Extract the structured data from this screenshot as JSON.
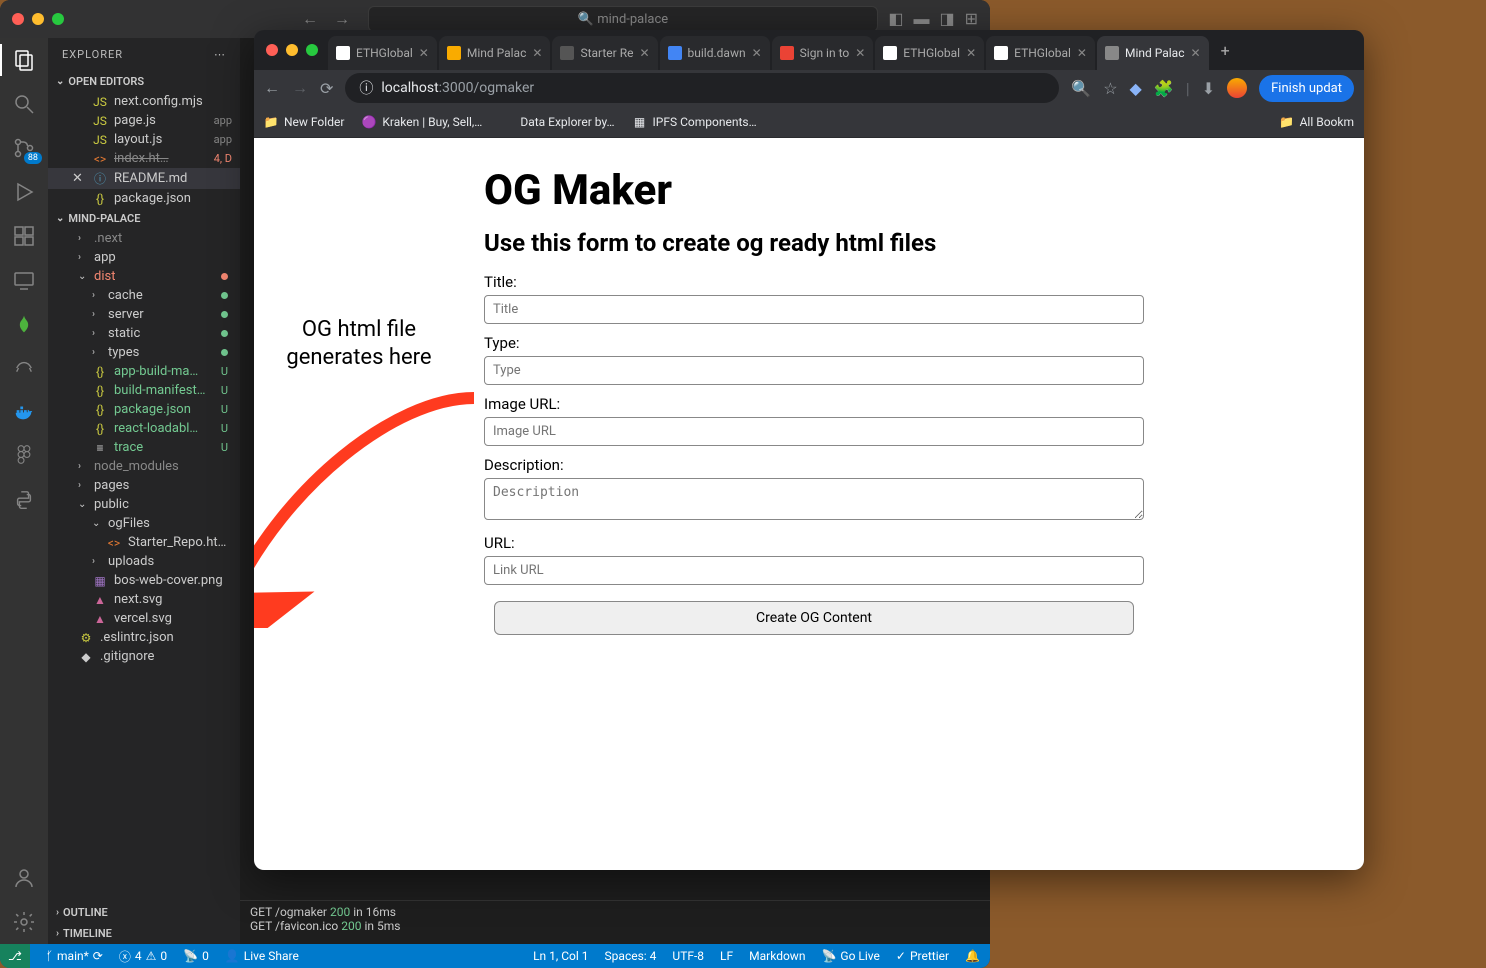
{
  "vscode": {
    "title": "mind-palace",
    "explorer_label": "EXPLORER",
    "open_editors_label": "OPEN EDITORS",
    "project_label": "MIND-PALACE",
    "outline_label": "OUTLINE",
    "timeline_label": "TIMELINE",
    "scm_badge": "88",
    "open_editors": [
      {
        "icon": "JS",
        "icls": "fi-js",
        "name": "next.config.mjs",
        "meta": ""
      },
      {
        "icon": "JS",
        "icls": "fi-js",
        "name": "page.js",
        "meta": "app"
      },
      {
        "icon": "JS",
        "icls": "fi-js",
        "name": "layout.js",
        "meta": "app"
      },
      {
        "icon": "<>",
        "icls": "fi-html",
        "name": "index.ht…",
        "meta": "4, D",
        "strike": true
      },
      {
        "icon": "ⓘ",
        "icls": "fi-md",
        "name": "README.md",
        "meta": "",
        "active": true,
        "close": true
      },
      {
        "icon": "{}",
        "icls": "fi-json",
        "name": "package.json",
        "meta": ""
      }
    ],
    "tree": [
      {
        "type": "folder",
        "name": ".next",
        "indent": 1,
        "chev": "›",
        "dim": true
      },
      {
        "type": "folder",
        "name": "app",
        "indent": 1,
        "chev": "›"
      },
      {
        "type": "folder",
        "name": "dist",
        "indent": 1,
        "chev": "⌄",
        "cls": "dist-red",
        "dot": "#f48771"
      },
      {
        "type": "folder",
        "name": "cache",
        "indent": 2,
        "chev": "›",
        "dot": "#73c991"
      },
      {
        "type": "folder",
        "name": "server",
        "indent": 2,
        "chev": "›",
        "dot": "#73c991"
      },
      {
        "type": "folder",
        "name": "static",
        "indent": 2,
        "chev": "›",
        "dot": "#73c991"
      },
      {
        "type": "folder",
        "name": "types",
        "indent": 2,
        "chev": "›",
        "dot": "#73c991"
      },
      {
        "type": "file",
        "icon": "{}",
        "icls": "fi-json",
        "name": "app-build-ma…",
        "indent": 2,
        "git": "U",
        "cls": "green-name"
      },
      {
        "type": "file",
        "icon": "{}",
        "icls": "fi-json",
        "name": "build-manifest…",
        "indent": 2,
        "git": "U",
        "cls": "green-name"
      },
      {
        "type": "file",
        "icon": "{}",
        "icls": "fi-json",
        "name": "package.json",
        "indent": 2,
        "git": "U",
        "cls": "green-name"
      },
      {
        "type": "file",
        "icon": "{}",
        "icls": "fi-json",
        "name": "react-loadabl…",
        "indent": 2,
        "git": "U",
        "cls": "green-name"
      },
      {
        "type": "file",
        "icon": "≡",
        "icls": "fi-folder",
        "name": "trace",
        "indent": 2,
        "git": "U",
        "cls": "green-name"
      },
      {
        "type": "folder",
        "name": "node_modules",
        "indent": 1,
        "chev": "›",
        "dim": true
      },
      {
        "type": "folder",
        "name": "pages",
        "indent": 1,
        "chev": "›"
      },
      {
        "type": "folder",
        "name": "public",
        "indent": 1,
        "chev": "⌄"
      },
      {
        "type": "folder",
        "name": "ogFiles",
        "indent": 2,
        "chev": "⌄"
      },
      {
        "type": "file",
        "icon": "<>",
        "icls": "fi-html",
        "name": "Starter_Repo.html",
        "indent": 3
      },
      {
        "type": "folder",
        "name": "uploads",
        "indent": 2,
        "chev": "›"
      },
      {
        "type": "file",
        "icon": "▦",
        "icls": "fi-img",
        "name": "bos-web-cover.png",
        "indent": 2
      },
      {
        "type": "file",
        "icon": "▲",
        "icls": "fi-svg",
        "name": "next.svg",
        "indent": 2
      },
      {
        "type": "file",
        "icon": "▲",
        "icls": "fi-svg",
        "name": "vercel.svg",
        "indent": 2
      },
      {
        "type": "file",
        "icon": "⚙",
        "icls": "fi-json",
        "name": ".eslintrc.json",
        "indent": 1
      },
      {
        "type": "file",
        "icon": "◆",
        "icls": "fi-folder",
        "name": ".gitignore",
        "indent": 1
      }
    ],
    "terminal": {
      "l1a": "GET /ogmaker",
      "l1b": "200",
      "l1c": "in 16ms",
      "l2a": "GET /favicon.ico",
      "l2b": "200",
      "l2c": "in 5ms"
    },
    "status": {
      "branch": "main*",
      "errors": "4",
      "warnings": "0",
      "port": "0",
      "liveshare": "Live Share",
      "pos": "Ln 1, Col 1",
      "spaces": "Spaces: 4",
      "enc": "UTF-8",
      "eol": "LF",
      "mode": "Markdown",
      "golive": "Go Live",
      "prettier": "Prettier"
    }
  },
  "browser": {
    "tabs": [
      {
        "title": "ETHGlobal",
        "color": "#fff"
      },
      {
        "title": "Mind Palac",
        "color": "#f9ab00"
      },
      {
        "title": "Starter Re",
        "color": "#555"
      },
      {
        "title": "build.dawn",
        "color": "#4285f4"
      },
      {
        "title": "Sign in to",
        "color": "#ea4335"
      },
      {
        "title": "ETHGlobal",
        "color": "#fff"
      },
      {
        "title": "ETHGlobal",
        "color": "#fff"
      },
      {
        "title": "Mind Palac",
        "color": "#888",
        "active": true
      }
    ],
    "url_host": "localhost",
    "url_port": ":3000",
    "url_path": "/ogmaker",
    "update": "Finish updat",
    "bookmarks": [
      {
        "label": "New Folder",
        "ico": "📁"
      },
      {
        "label": "Kraken | Buy, Sell,…",
        "ico": "🟣"
      },
      {
        "label": "Data Explorer by…",
        "ico": "</>"
      },
      {
        "label": "IPFS Components…",
        "ico": "▦"
      }
    ],
    "all_bookmarks": "All Bookm"
  },
  "form": {
    "h1": "OG Maker",
    "h2": "Use this form to create og ready html files",
    "title_label": "Title:",
    "title_ph": "Title",
    "type_label": "Type:",
    "type_ph": "Type",
    "image_label": "Image URL:",
    "image_ph": "Image URL",
    "desc_label": "Description:",
    "desc_ph": "Description",
    "url_label": "URL:",
    "url_ph": "Link URL",
    "submit": "Create OG Content"
  },
  "annotation": "OG html file generates here"
}
